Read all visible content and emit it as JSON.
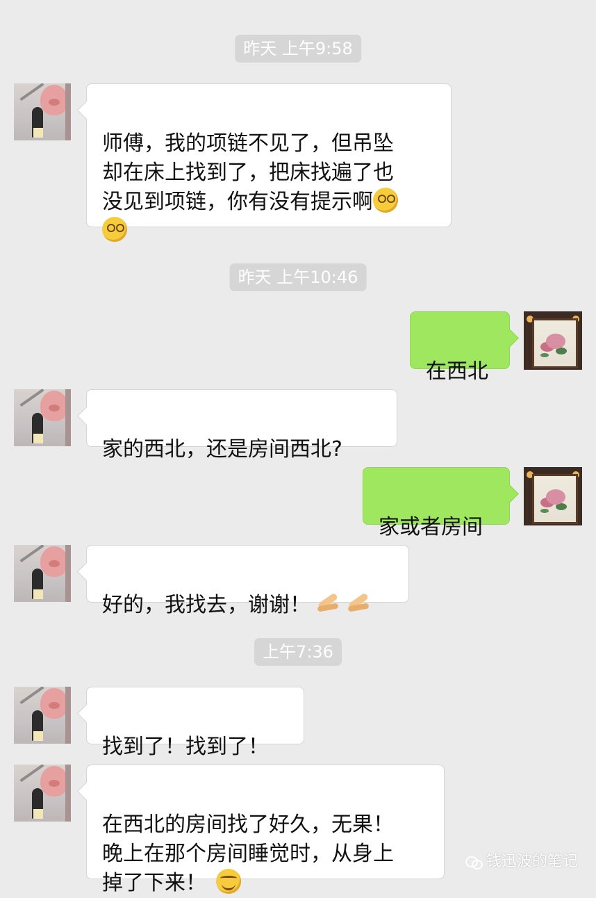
{
  "messages": [
    {
      "type": "time",
      "text": "昨天 上午9:58"
    },
    {
      "type": "in",
      "text": "师傅，我的项链不见了，但吊坠\n却在床上找到了，把床找遍了也\n没见到项链，你有没有提示啊",
      "emoji_after": "dizzy-face-icon",
      "emoji_count": 2
    },
    {
      "type": "time",
      "text": "昨天 上午10:46"
    },
    {
      "type": "out",
      "text": "在西北"
    },
    {
      "type": "in",
      "text": "家的西北，还是房间西北?"
    },
    {
      "type": "out",
      "text": "家或者房间"
    },
    {
      "type": "in",
      "text": "好的，我找去，谢谢！",
      "emoji_after": "pointing-hands-icon",
      "emoji_count": 2
    },
    {
      "type": "time",
      "text": "上午7:36"
    },
    {
      "type": "in",
      "text": "找到了！找到了！"
    },
    {
      "type": "in",
      "text": "在西北的房间找了好久，无果！\n晚上在那个房间睡觉时，从身上\n掉了下来！",
      "emoji_after": "hugging-face-icon",
      "emoji_count": 1
    }
  ],
  "watermark": {
    "text": "钱迅波的笔记",
    "icon": "wechat-icon"
  },
  "colors": {
    "background": "#ebebeb",
    "incoming": "#ffffff",
    "outgoing": "#9ee75e",
    "timestamp_bg": "#d6d6d6"
  }
}
